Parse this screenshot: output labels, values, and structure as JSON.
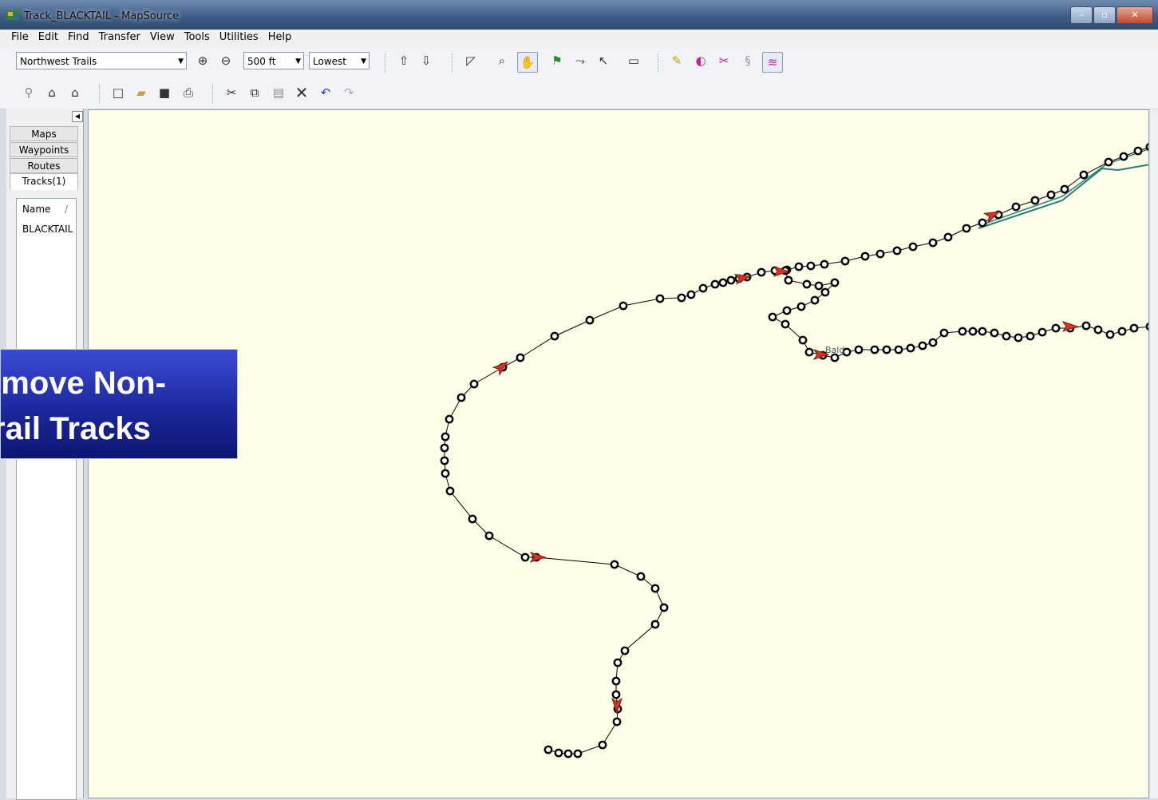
{
  "window": {
    "title": "Track_BLACKTAIL - MapSource"
  },
  "menu": [
    "File",
    "Edit",
    "Find",
    "Transfer",
    "View",
    "Tools",
    "Utilities",
    "Help"
  ],
  "toolbar": {
    "map_product": "Northwest Trails",
    "zoom_level": "500 ft",
    "detail_level": "Lowest"
  },
  "sidebar": {
    "tabs": [
      "Maps",
      "Waypoints",
      "Routes",
      "Tracks(1)"
    ],
    "active_tab": "Tracks(1)",
    "list_header": "Name",
    "sort_glyph": "/",
    "items": [
      "BLACKTAIL"
    ]
  },
  "map": {
    "partial_label": "Bald"
  },
  "callout": {
    "line1": "emove Non-",
    "line2": "rail Tracks"
  },
  "colors": {
    "track": "#000000",
    "trail_line": "#2a7a7a",
    "map_bg": "#fefee9",
    "marker": "#d8331f",
    "callout_bg": "#1a2598"
  }
}
